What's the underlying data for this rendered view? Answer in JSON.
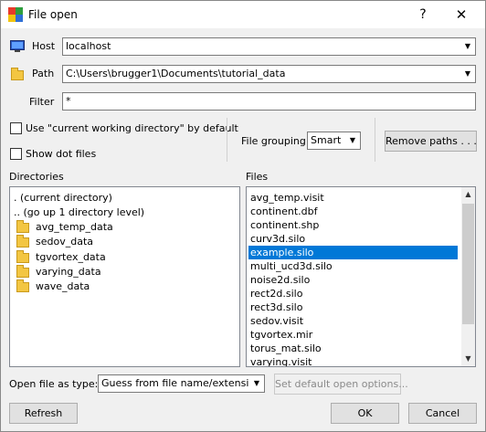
{
  "window": {
    "title": "File open",
    "help_label": "?",
    "close_label": "✕"
  },
  "host": {
    "label": "Host",
    "value": "localhost",
    "icon": "monitor-icon"
  },
  "path": {
    "label": "Path",
    "value": "C:\\Users\\brugger1\\Documents\\tutorial_data",
    "icon": "folder-icon"
  },
  "filter": {
    "label": "Filter",
    "value": "*"
  },
  "options": {
    "use_cwd_label": "Use \"current working directory\" by default",
    "show_dot_label": "Show dot files",
    "use_cwd_checked": false,
    "show_dot_checked": false,
    "file_grouping_label": "File grouping",
    "file_grouping_value": "Smart",
    "remove_paths_label": "Remove paths . . ."
  },
  "directories": {
    "header": "Directories",
    "items": [
      ". (current directory)",
      ".. (go up 1 directory level)",
      "avg_temp_data",
      "sedov_data",
      "tgvortex_data",
      "varying_data",
      "wave_data"
    ]
  },
  "files": {
    "header": "Files",
    "items": [
      "avg_temp.visit",
      "continent.dbf",
      "continent.shp",
      "curv3d.silo",
      "example.silo",
      "multi_ucd3d.silo",
      "noise2d.silo",
      "rect2d.silo",
      "rect3d.silo",
      "sedov.visit",
      "tgvortex.mir",
      "torus_mat.silo",
      "varying.visit"
    ],
    "selected": "example.silo"
  },
  "open_as": {
    "label": "Open file as type:",
    "value": "Guess from file name/extension",
    "default_options_label": "Set default open options..."
  },
  "buttons": {
    "refresh": "Refresh",
    "ok": "OK",
    "cancel": "Cancel"
  },
  "colors": {
    "selection": "#0078d7",
    "folder": "#f3c642",
    "window_bg": "#f0f0f0"
  }
}
